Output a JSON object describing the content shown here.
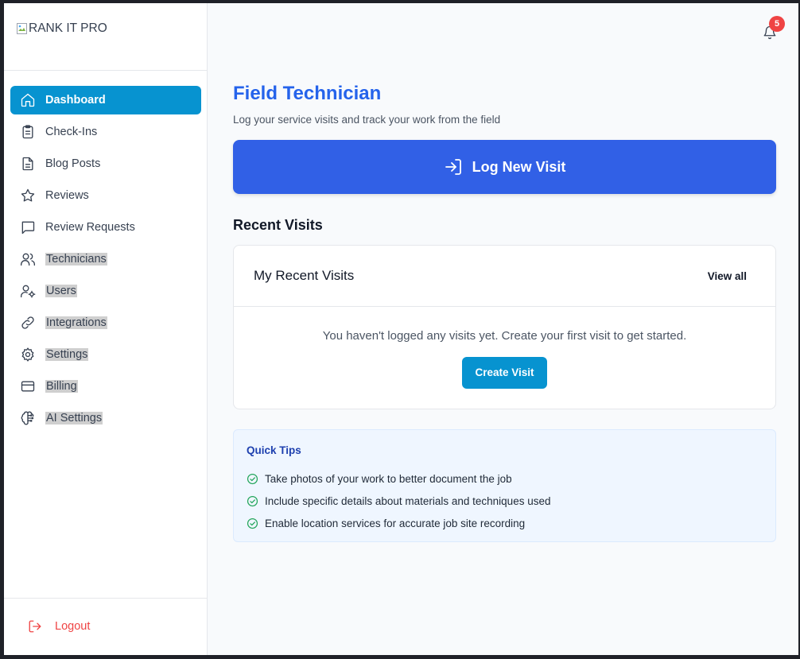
{
  "brand": {
    "logo_alt": "RANK IT PRO"
  },
  "sidebar": {
    "items": [
      {
        "label": "Dashboard",
        "icon": "home-icon"
      },
      {
        "label": "Check-Ins",
        "icon": "clipboard-icon"
      },
      {
        "label": "Blog Posts",
        "icon": "document-icon"
      },
      {
        "label": "Reviews",
        "icon": "star-icon"
      },
      {
        "label": "Review Requests",
        "icon": "message-icon"
      },
      {
        "label": "Technicians",
        "icon": "users-icon"
      },
      {
        "label": "Users",
        "icon": "user-cog-icon"
      },
      {
        "label": "Integrations",
        "icon": "link-icon"
      },
      {
        "label": "Settings",
        "icon": "gear-icon"
      },
      {
        "label": "Billing",
        "icon": "credit-card-icon"
      },
      {
        "label": "AI Settings",
        "icon": "brain-icon"
      }
    ],
    "logout_label": "Logout"
  },
  "header": {
    "notification_count": "5"
  },
  "main": {
    "title": "Field Technician",
    "subtitle": "Log your service visits and track your work from the field",
    "log_button_label": "Log New Visit",
    "recent_section_title": "Recent Visits",
    "card": {
      "title": "My Recent Visits",
      "view_all_label": "View all",
      "empty_message": "You haven't logged any visits yet. Create your first visit to get started.",
      "create_button_label": "Create Visit"
    },
    "tips": {
      "title": "Quick Tips",
      "items": [
        "Take photos of your work to better document the job",
        "Include specific details about materials and techniques used",
        "Enable location services for accurate job site recording"
      ]
    }
  },
  "colors": {
    "accent_primary": "#0793d0",
    "accent_blue": "#3160e6",
    "title_blue": "#2563eb",
    "danger": "#ef4444",
    "success": "#22a55a"
  }
}
